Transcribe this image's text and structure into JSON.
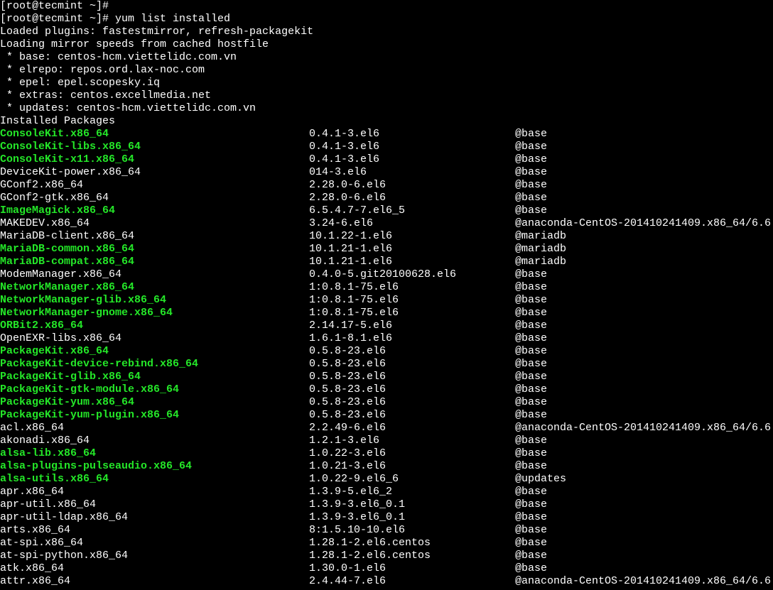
{
  "prompt_empty": "[root@tecmint ~]# ",
  "prompt_cmd": "[root@tecmint ~]# yum list installed",
  "pre_lines": [
    "Loaded plugins: fastestmirror, refresh-packagekit",
    "Loading mirror speeds from cached hostfile",
    " * base: centos-hcm.viettelidc.com.vn",
    " * elrepo: repos.ord.lax-noc.com",
    " * epel: epel.scopesky.iq",
    " * extras: centos.excellmedia.net",
    " * updates: centos-hcm.viettelidc.com.vn",
    "Installed Packages"
  ],
  "packages": [
    {
      "name": "ConsoleKit.x86_64",
      "ver": "0.4.1-3.el6",
      "repo": "@base",
      "hl": true
    },
    {
      "name": "ConsoleKit-libs.x86_64",
      "ver": "0.4.1-3.el6",
      "repo": "@base",
      "hl": true
    },
    {
      "name": "ConsoleKit-x11.x86_64",
      "ver": "0.4.1-3.el6",
      "repo": "@base",
      "hl": true
    },
    {
      "name": "DeviceKit-power.x86_64",
      "ver": "014-3.el6",
      "repo": "@base",
      "hl": false
    },
    {
      "name": "GConf2.x86_64",
      "ver": "2.28.0-6.el6",
      "repo": "@base",
      "hl": false
    },
    {
      "name": "GConf2-gtk.x86_64",
      "ver": "2.28.0-6.el6",
      "repo": "@base",
      "hl": false
    },
    {
      "name": "ImageMagick.x86_64",
      "ver": "6.5.4.7-7.el6_5",
      "repo": "@base",
      "hl": true
    },
    {
      "name": "MAKEDEV.x86_64",
      "ver": "3.24-6.el6",
      "repo": "@anaconda-CentOS-201410241409.x86_64/6.6",
      "hl": false
    },
    {
      "name": "MariaDB-client.x86_64",
      "ver": "10.1.22-1.el6",
      "repo": "@mariadb",
      "hl": false
    },
    {
      "name": "MariaDB-common.x86_64",
      "ver": "10.1.21-1.el6",
      "repo": "@mariadb",
      "hl": true
    },
    {
      "name": "MariaDB-compat.x86_64",
      "ver": "10.1.21-1.el6",
      "repo": "@mariadb",
      "hl": true
    },
    {
      "name": "ModemManager.x86_64",
      "ver": "0.4.0-5.git20100628.el6",
      "repo": "@base",
      "hl": false
    },
    {
      "name": "NetworkManager.x86_64",
      "ver": "1:0.8.1-75.el6",
      "repo": "@base",
      "hl": true
    },
    {
      "name": "NetworkManager-glib.x86_64",
      "ver": "1:0.8.1-75.el6",
      "repo": "@base",
      "hl": true
    },
    {
      "name": "NetworkManager-gnome.x86_64",
      "ver": "1:0.8.1-75.el6",
      "repo": "@base",
      "hl": true
    },
    {
      "name": "ORBit2.x86_64",
      "ver": "2.14.17-5.el6",
      "repo": "@base",
      "hl": true
    },
    {
      "name": "OpenEXR-libs.x86_64",
      "ver": "1.6.1-8.1.el6",
      "repo": "@base",
      "hl": false
    },
    {
      "name": "PackageKit.x86_64",
      "ver": "0.5.8-23.el6",
      "repo": "@base",
      "hl": true
    },
    {
      "name": "PackageKit-device-rebind.x86_64",
      "ver": "0.5.8-23.el6",
      "repo": "@base",
      "hl": true
    },
    {
      "name": "PackageKit-glib.x86_64",
      "ver": "0.5.8-23.el6",
      "repo": "@base",
      "hl": true
    },
    {
      "name": "PackageKit-gtk-module.x86_64",
      "ver": "0.5.8-23.el6",
      "repo": "@base",
      "hl": true
    },
    {
      "name": "PackageKit-yum.x86_64",
      "ver": "0.5.8-23.el6",
      "repo": "@base",
      "hl": true
    },
    {
      "name": "PackageKit-yum-plugin.x86_64",
      "ver": "0.5.8-23.el6",
      "repo": "@base",
      "hl": true
    },
    {
      "name": "acl.x86_64",
      "ver": "2.2.49-6.el6",
      "repo": "@anaconda-CentOS-201410241409.x86_64/6.6",
      "hl": false
    },
    {
      "name": "akonadi.x86_64",
      "ver": "1.2.1-3.el6",
      "repo": "@base",
      "hl": false
    },
    {
      "name": "alsa-lib.x86_64",
      "ver": "1.0.22-3.el6",
      "repo": "@base",
      "hl": true
    },
    {
      "name": "alsa-plugins-pulseaudio.x86_64",
      "ver": "1.0.21-3.el6",
      "repo": "@base",
      "hl": true
    },
    {
      "name": "alsa-utils.x86_64",
      "ver": "1.0.22-9.el6_6",
      "repo": "@updates",
      "hl": true
    },
    {
      "name": "apr.x86_64",
      "ver": "1.3.9-5.el6_2",
      "repo": "@base",
      "hl": false
    },
    {
      "name": "apr-util.x86_64",
      "ver": "1.3.9-3.el6_0.1",
      "repo": "@base",
      "hl": false
    },
    {
      "name": "apr-util-ldap.x86_64",
      "ver": "1.3.9-3.el6_0.1",
      "repo": "@base",
      "hl": false
    },
    {
      "name": "arts.x86_64",
      "ver": "8:1.5.10-10.el6",
      "repo": "@base",
      "hl": false
    },
    {
      "name": "at-spi.x86_64",
      "ver": "1.28.1-2.el6.centos",
      "repo": "@base",
      "hl": false
    },
    {
      "name": "at-spi-python.x86_64",
      "ver": "1.28.1-2.el6.centos",
      "repo": "@base",
      "hl": false
    },
    {
      "name": "atk.x86_64",
      "ver": "1.30.0-1.el6",
      "repo": "@base",
      "hl": false
    },
    {
      "name": "attr.x86_64",
      "ver": "2.4.44-7.el6",
      "repo": "@anaconda-CentOS-201410241409.x86_64/6.6",
      "hl": false
    }
  ]
}
